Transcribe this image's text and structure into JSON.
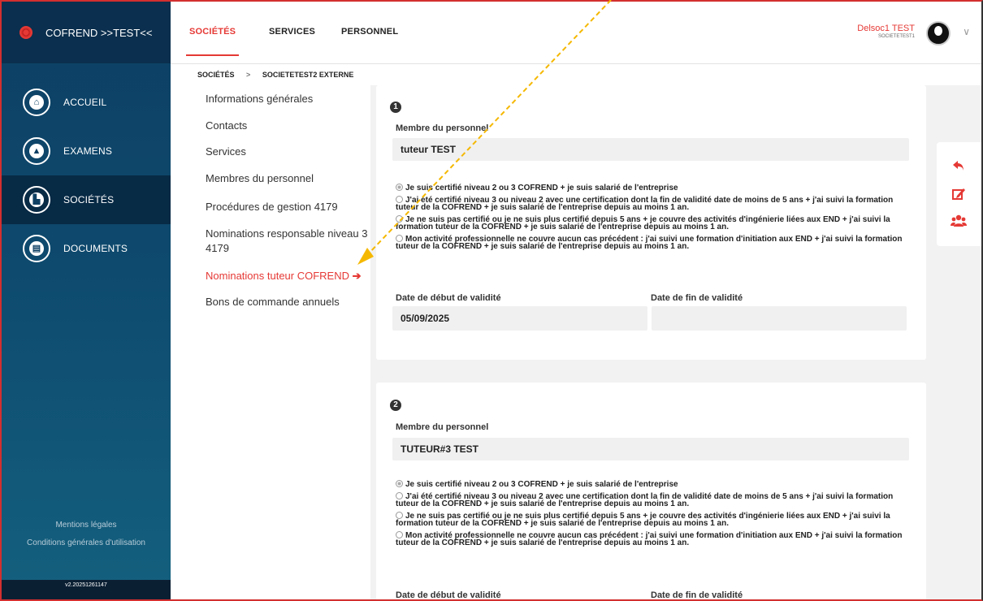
{
  "app": {
    "title": "COFREND >>TEST<<"
  },
  "sidebar": {
    "items": [
      {
        "label": "ACCUEIL",
        "icon": "home-icon",
        "glyph": "⌂"
      },
      {
        "label": "EXAMENS",
        "icon": "graduation-cap-icon",
        "glyph": "▲"
      },
      {
        "label": "SOCIÉTÉS",
        "icon": "factory-icon",
        "glyph": "▙"
      },
      {
        "label": "DOCUMENTS",
        "icon": "document-icon",
        "glyph": "▤"
      }
    ],
    "active_item": "SOCIÉTÉS",
    "footer_links": [
      "Mentions légales",
      "Conditions générales d'utilisation"
    ],
    "version": "v2.20251261147"
  },
  "header": {
    "tabs": [
      "SOCIÉTÉS",
      "SERVICES",
      "PERSONNEL"
    ],
    "active_tab": "SOCIÉTÉS",
    "user_name": "Delsoc1 TEST",
    "user_company": "SOCIETETEST1"
  },
  "breadcrumb": [
    "SOCIÉTÉS",
    ">",
    "SOCIETETEST2 EXTERNE"
  ],
  "submenu": {
    "items": [
      "Informations générales",
      "Contacts",
      "Services",
      "Membres du personnel",
      "Procédures de gestion 4179",
      "Nominations responsable niveau 3 4179",
      "Nominations tuteur COFREND",
      "Bons de commande annuels"
    ],
    "active_item": "Nominations tuteur COFREND"
  },
  "cards": [
    {
      "number": "1",
      "member_label": "Membre du personnel",
      "member_value": "tuteur TEST",
      "options": [
        "Je suis certifié niveau 2 ou 3 COFREND + je suis salarié de l'entreprise",
        "J'ai été certifié niveau 3 ou niveau 2 avec une certification dont la fin de validité date de moins de 5 ans + j'ai suivi la formation tuteur de la COFREND + je suis salarié de l'entreprise depuis au moins 1 an.",
        "Je ne suis pas certifié ou je ne suis plus certifié depuis 5 ans + je couvre des activités d'ingénierie liées aux END + j'ai suivi la formation tuteur de la COFREND + je suis salarié de l'entreprise depuis au moins 1 an.",
        "Mon activité professionnelle ne couvre aucun cas précédent : j'ai suivi une formation d'initiation aux END + j'ai suivi la formation tuteur de la COFREND + je suis salarié de l'entreprise depuis au moins 1 an."
      ],
      "start_label": "Date de début de validité",
      "start_value": "05/09/2025",
      "end_label": "Date de fin de validité",
      "end_value": ""
    },
    {
      "number": "2",
      "member_label": "Membre du personnel",
      "member_value": "TUTEUR#3 TEST",
      "options": [
        "Je suis certifié niveau 2 ou 3 COFREND + je suis salarié de l'entreprise",
        "J'ai été certifié niveau 3 ou niveau 2 avec une certification dont la fin de validité date de moins de 5 ans + j'ai suivi la formation tuteur de la COFREND + je suis salarié de l'entreprise depuis au moins 1 an.",
        "Je ne suis pas certifié ou je ne suis plus certifié depuis 5 ans + je couvre des activités d'ingénierie liées aux END + j'ai suivi la formation tuteur de la COFREND + je suis salarié de l'entreprise depuis au moins 1 an.",
        "Mon activité professionnelle ne couvre aucun cas précédent : j'ai suivi une formation d'initiation aux END + j'ai suivi la formation tuteur de la COFREND + je suis salarié de l'entreprise depuis au moins 1 an."
      ],
      "start_label": "Date de début de validité",
      "end_label": "Date de fin de validité"
    }
  ],
  "tools": [
    {
      "icon": "undo-arrow-icon",
      "glyph": "↶"
    },
    {
      "icon": "edit-icon",
      "glyph": "✎"
    },
    {
      "icon": "users-icon",
      "glyph": "👥"
    }
  ],
  "colors": {
    "accent": "#e53935",
    "sidebar": "#0d3f63",
    "annotation_arrow": "#f5b800"
  }
}
